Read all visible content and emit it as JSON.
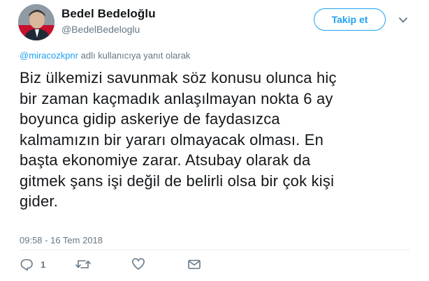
{
  "header": {
    "name": "Bedel Bedeloğlu",
    "handle": "@BedelBedeloglu",
    "follow_label": "Takip et"
  },
  "reply": {
    "mention": "@mirac​ozkpnr",
    "text": " adlı kullanıcıya yanıt olarak"
  },
  "tweet": {
    "lines": [
      "Biz ülkemizi savunmak söz konusu olunca hiç",
      "bir zaman kaçmadık anlaşılmayan nokta 6 ay",
      "boyunca gidip askeriye de faydasızca",
      "kalmamızın bir yararı olmayacak olması. En",
      "başta ekonomiye zarar. Atsubay olarak da",
      "gitmek şans işi değil de belirli olsa bir çok kişi",
      "gider."
    ],
    "timestamp": "09:58 - 16 Tem 2018"
  },
  "actions": {
    "reply_count": "1",
    "retweet_count": "",
    "like_count": ""
  },
  "icons": {
    "reply": "reply-icon",
    "retweet": "retweet-icon",
    "like": "heart-icon",
    "dm": "envelope-icon",
    "caret": "chevron-down-icon"
  },
  "colors": {
    "accent": "#1da1f2",
    "secondary_text": "#657786",
    "primary_text": "#14171a"
  }
}
